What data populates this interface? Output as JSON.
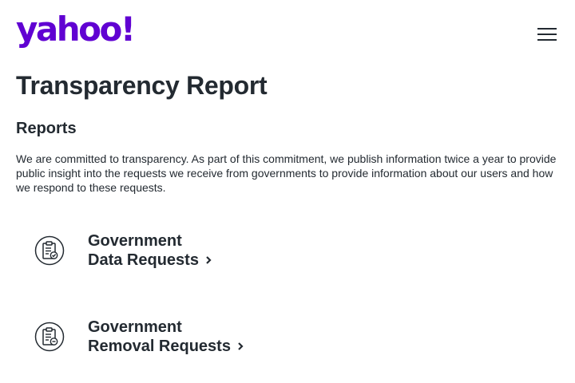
{
  "header": {
    "logo_text": "yahoo!",
    "menu_icon": "hamburger-menu-icon"
  },
  "page": {
    "title": "Transparency Report",
    "section_title": "Reports",
    "intro": "We are committed to transparency. As part of this commitment, we publish information twice a year to provide public insight into the requests we receive from governments to provide information about our users and how we respond to these requests."
  },
  "reports": [
    {
      "line1": "Government",
      "line2": "Data Requests",
      "icon": "clipboard-check-icon"
    },
    {
      "line1": "Government",
      "line2": "Removal Requests",
      "icon": "clipboard-remove-icon"
    }
  ],
  "colors": {
    "brand": "#6001d2",
    "text": "#232a31",
    "background": "#ffffff"
  }
}
